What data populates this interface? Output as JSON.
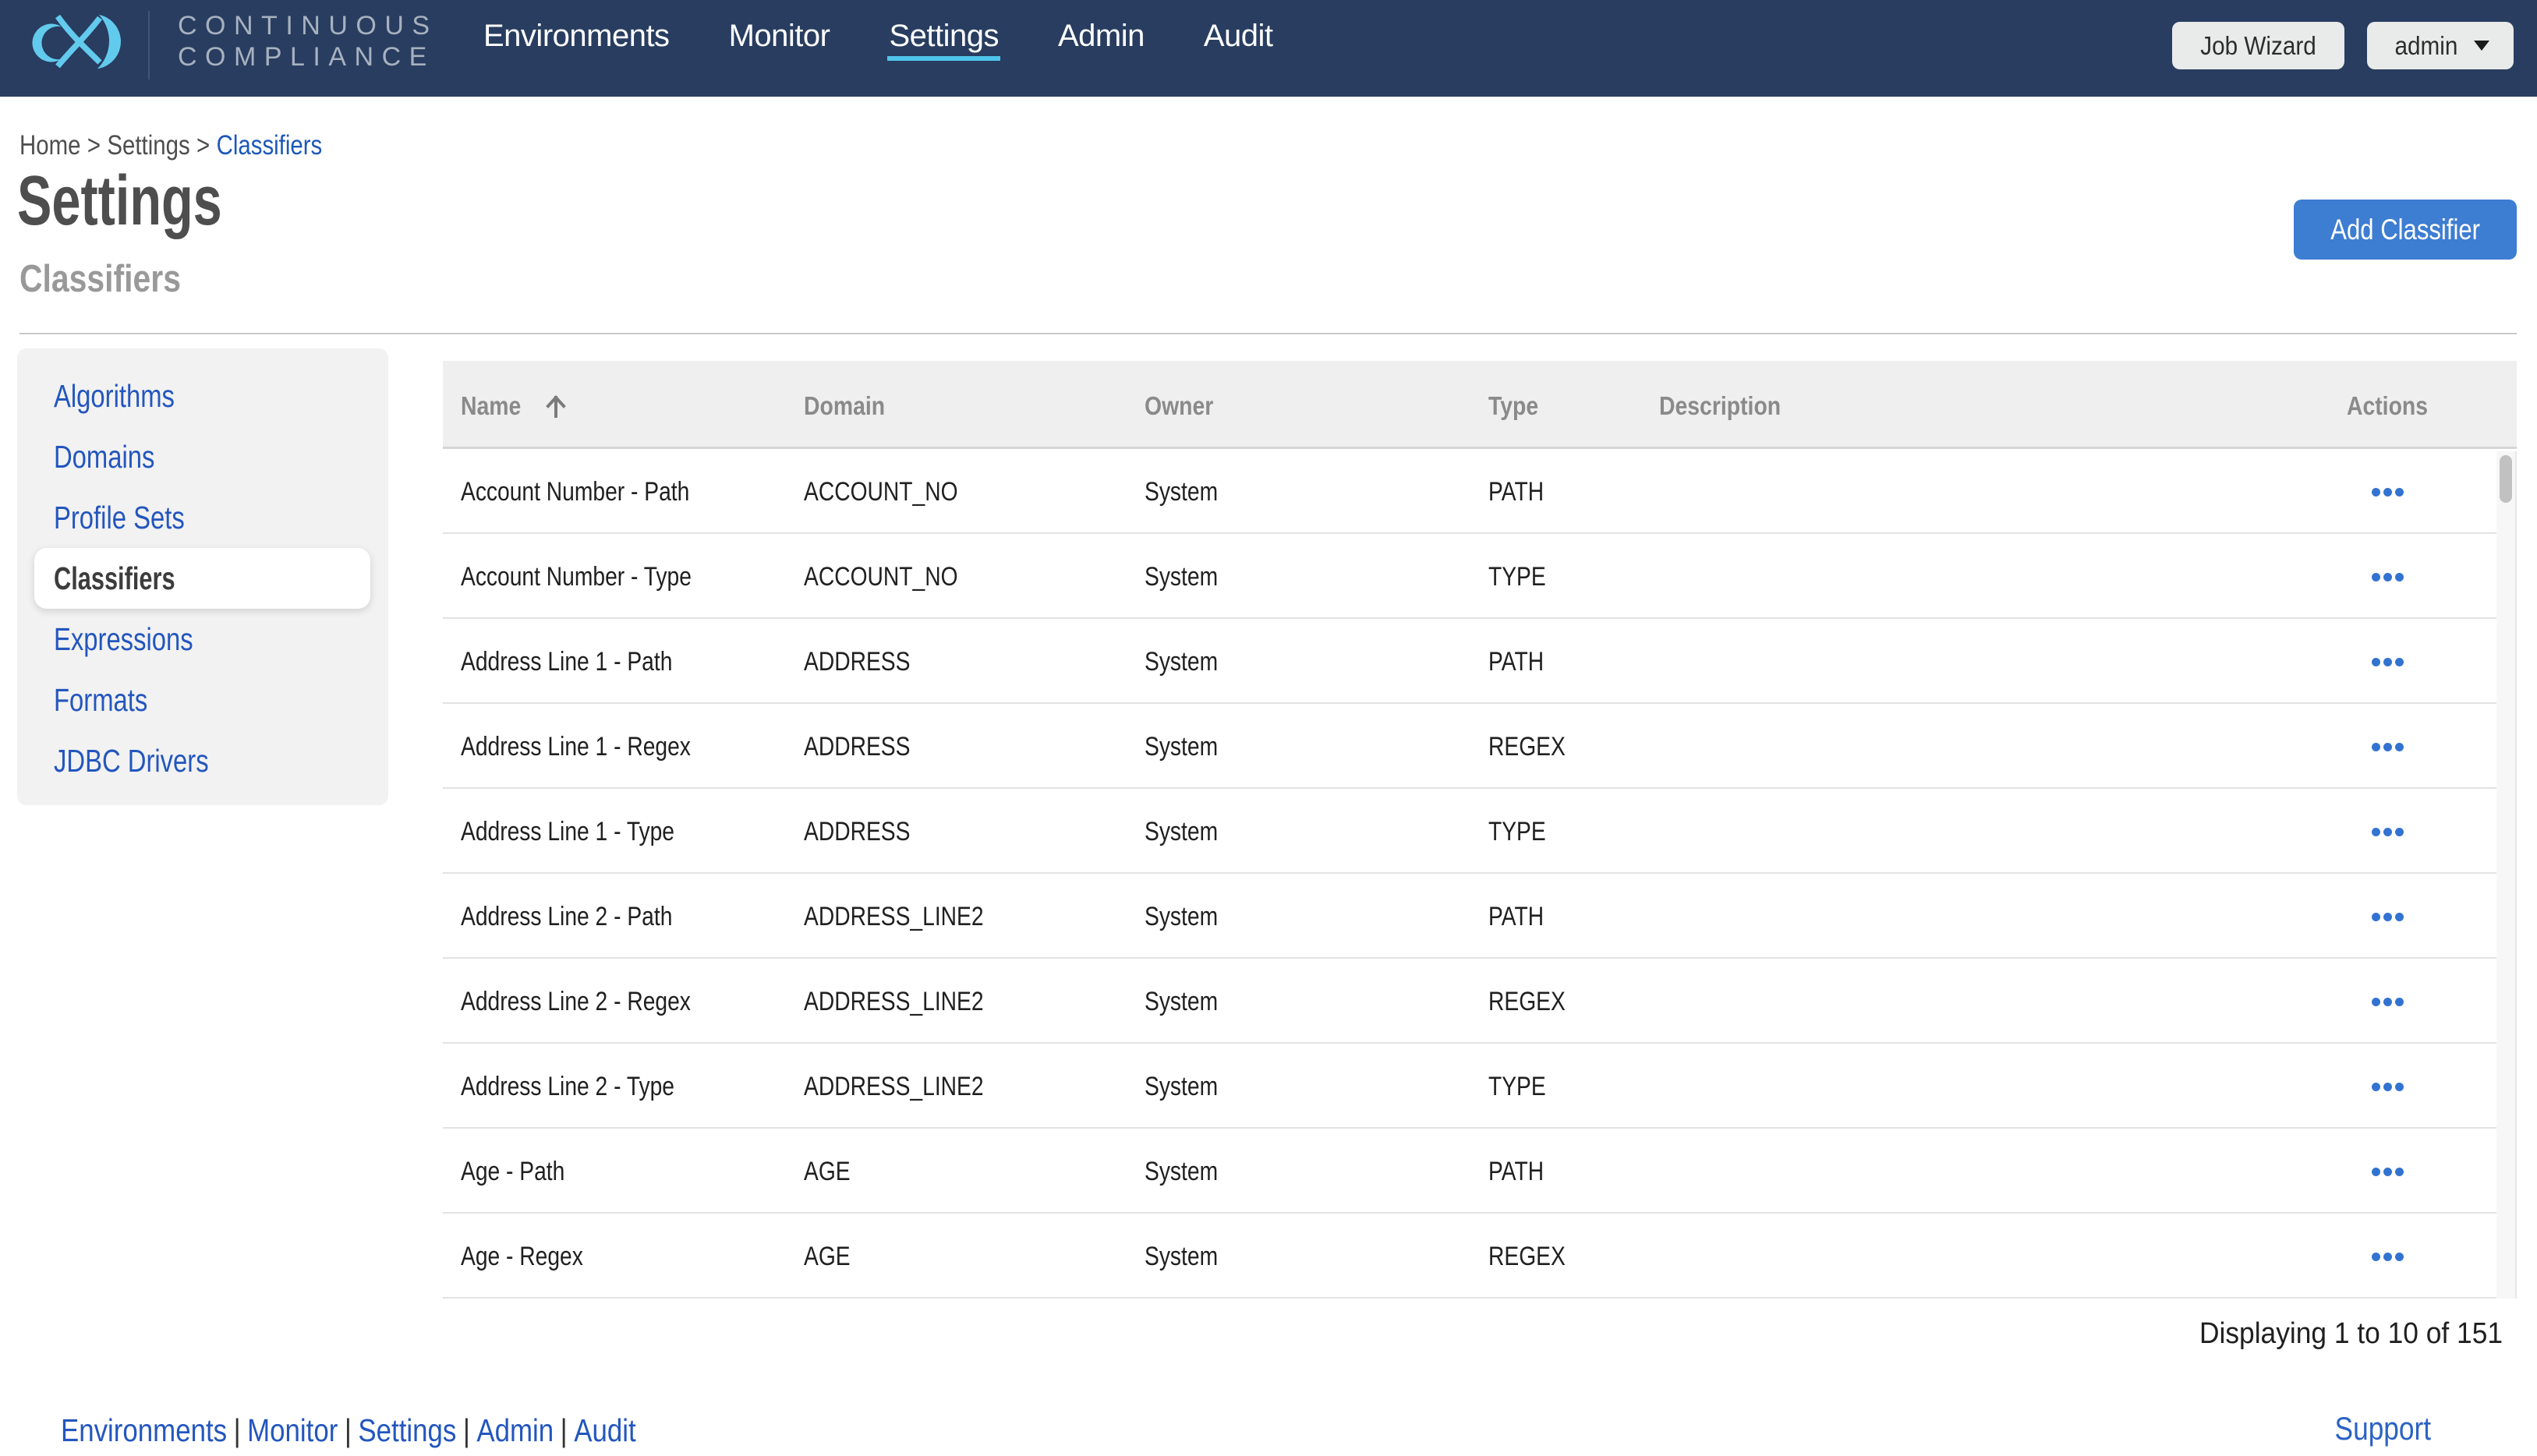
{
  "navbar": {
    "brand_line1": "CONTINUOUS",
    "brand_line2": "COMPLIANCE",
    "links": [
      {
        "label": "Environments",
        "active": false
      },
      {
        "label": "Monitor",
        "active": false
      },
      {
        "label": "Settings",
        "active": true
      },
      {
        "label": "Admin",
        "active": false
      },
      {
        "label": "Audit",
        "active": false
      }
    ],
    "job_wizard_label": "Job Wizard",
    "user_menu_label": "admin"
  },
  "breadcrumb": {
    "items": [
      "Home",
      "Settings",
      "Classifiers"
    ],
    "separator": ">"
  },
  "page": {
    "title": "Settings",
    "section_title": "Classifiers",
    "add_button_label": "Add Classifier"
  },
  "sidebar": {
    "items": [
      {
        "label": "Algorithms",
        "active": false
      },
      {
        "label": "Domains",
        "active": false
      },
      {
        "label": "Profile Sets",
        "active": false
      },
      {
        "label": "Classifiers",
        "active": true
      },
      {
        "label": "Expressions",
        "active": false
      },
      {
        "label": "Formats",
        "active": false
      },
      {
        "label": "JDBC Drivers",
        "active": false
      }
    ]
  },
  "table": {
    "columns": [
      "Name",
      "Domain",
      "Owner",
      "Type",
      "Description",
      "Actions"
    ],
    "sorted_by": "Name",
    "sort_direction": "ascending",
    "rows": [
      {
        "name": "Account Number - Path",
        "domain": "ACCOUNT_NO",
        "owner": "System",
        "type": "PATH",
        "description": ""
      },
      {
        "name": "Account Number - Type",
        "domain": "ACCOUNT_NO",
        "owner": "System",
        "type": "TYPE",
        "description": ""
      },
      {
        "name": "Address Line 1 - Path",
        "domain": "ADDRESS",
        "owner": "System",
        "type": "PATH",
        "description": ""
      },
      {
        "name": "Address Line 1 - Regex",
        "domain": "ADDRESS",
        "owner": "System",
        "type": "REGEX",
        "description": ""
      },
      {
        "name": "Address Line 1 - Type",
        "domain": "ADDRESS",
        "owner": "System",
        "type": "TYPE",
        "description": ""
      },
      {
        "name": "Address Line 2 - Path",
        "domain": "ADDRESS_LINE2",
        "owner": "System",
        "type": "PATH",
        "description": ""
      },
      {
        "name": "Address Line 2 - Regex",
        "domain": "ADDRESS_LINE2",
        "owner": "System",
        "type": "REGEX",
        "description": ""
      },
      {
        "name": "Address Line 2 - Type",
        "domain": "ADDRESS_LINE2",
        "owner": "System",
        "type": "TYPE",
        "description": ""
      },
      {
        "name": "Age - Path",
        "domain": "AGE",
        "owner": "System",
        "type": "PATH",
        "description": ""
      },
      {
        "name": "Age - Regex",
        "domain": "AGE",
        "owner": "System",
        "type": "REGEX",
        "description": ""
      }
    ],
    "status": "Displaying 1 to 10 of 151"
  },
  "footer": {
    "links": [
      "Environments",
      "Monitor",
      "Settings",
      "Admin",
      "Audit"
    ],
    "separator": "|",
    "support_label": "Support"
  },
  "colors": {
    "navbar_bg": "#283D60",
    "logo_blue": "#62CAED",
    "active_underline": "#50C5EC",
    "link_blue": "#2356BE",
    "button_blue": "#3D7DD2",
    "actions_dots_blue": "#3273D1",
    "header_gray": "#EFEFEF",
    "sidebar_gray": "#F2F2F2"
  }
}
